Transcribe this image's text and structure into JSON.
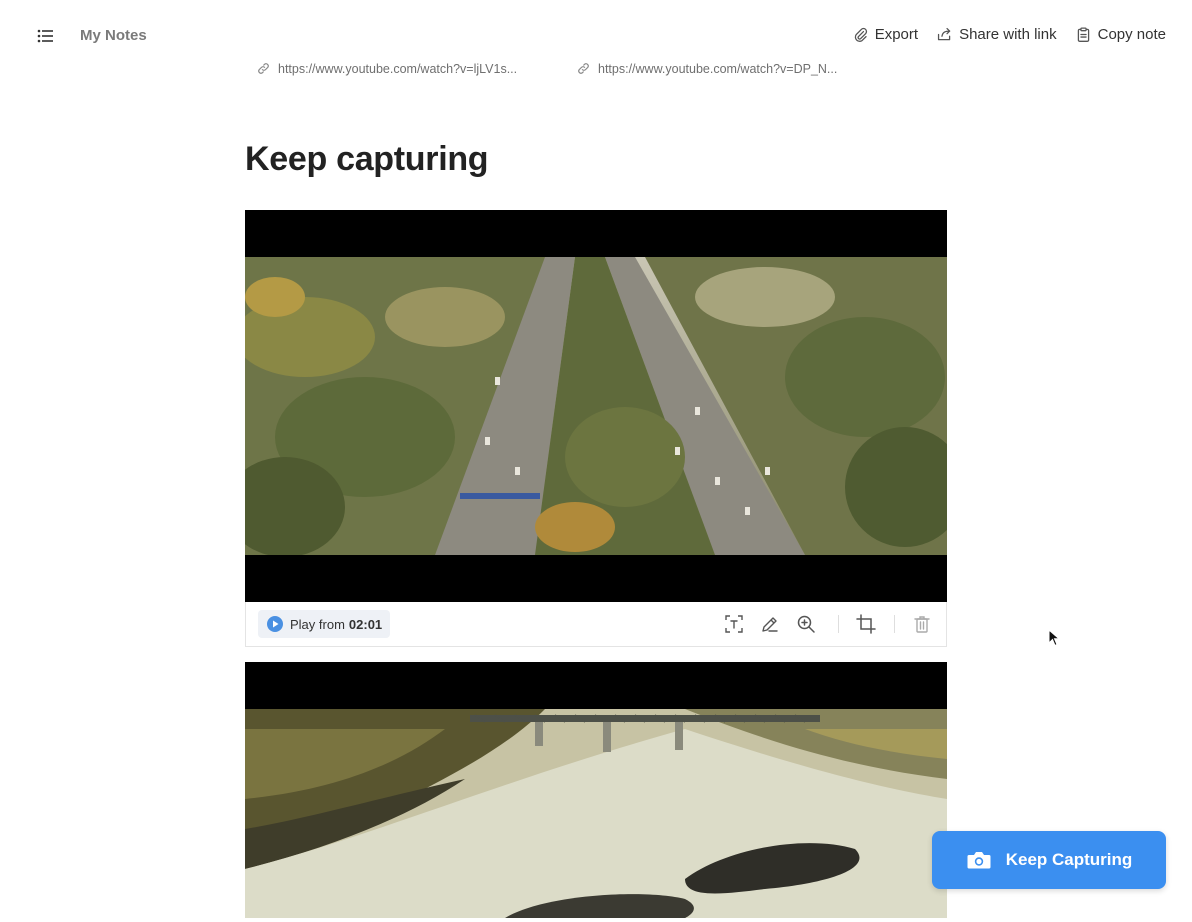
{
  "header": {
    "title": "My Notes",
    "menu_icon": "list-icon",
    "actions": [
      {
        "label": "Export",
        "icon": "paperclip-icon"
      },
      {
        "label": "Share with link",
        "icon": "share-icon"
      },
      {
        "label": "Copy note",
        "icon": "clipboard-icon"
      }
    ]
  },
  "sources": [
    {
      "url": "https://www.youtube.com/watch?v=ljLV1s...",
      "icon": "link-icon"
    },
    {
      "url": "https://www.youtube.com/watch?v=DP_N...",
      "icon": "link-icon"
    }
  ],
  "note": {
    "heading": "Keep capturing"
  },
  "captures": [
    {
      "play_label": "Play from",
      "play_time": "02:01",
      "tools": [
        "text-extract-icon",
        "edit-icon",
        "zoom-in-icon",
        "crop-icon",
        "trash-icon"
      ]
    }
  ],
  "fab": {
    "label": "Keep Capturing",
    "icon": "camera-icon"
  },
  "colors": {
    "accent": "#3b8ff0",
    "text": "#2b2b2b",
    "muted": "#7a7a7a"
  }
}
